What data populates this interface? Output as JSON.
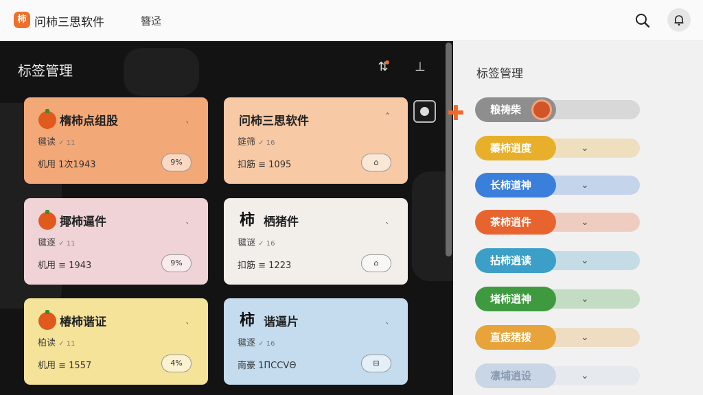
{
  "topbar": {
    "logo_glyph": "柿",
    "app_title": "问柿三思软件",
    "nav_link": "簪迳",
    "icons": [
      "search-icon",
      "bell-icon"
    ]
  },
  "left_panel": {
    "title": "标签管理",
    "header_icons": [
      "sort-icon",
      "upload-icon"
    ],
    "accent": "#ef6a2a",
    "cards": [
      {
        "icon": "tomato",
        "title": "楕柿点组股",
        "sub": "毽读",
        "sub_mark": "✓ 11",
        "stat": "机用 1次1943",
        "pill": "9%",
        "chevron": "ˎ",
        "bg": "#f3a878"
      },
      {
        "icon": "none",
        "title": "问柿三思软件",
        "sub": "筵筛",
        "sub_mark": "✓ 16",
        "stat": "扣筋 ≡ 1095",
        "pill": "⌂",
        "chevron": "ˆ",
        "bg": "#f7c9a4"
      },
      {
        "icon": "tomato",
        "title": "揶柿逼件",
        "sub": "毽逐",
        "sub_mark": "✓ 11",
        "stat": "机用 ≡ 1943",
        "pill": "9%",
        "chevron": "ˎ",
        "bg": "#f0d3d6"
      },
      {
        "icon": "kanji",
        "glyph": "柿",
        "title": "栖猪件",
        "sub": "毽谜",
        "sub_mark": "✓ 16",
        "stat": "扣筋 ≡ 1223",
        "pill": "⌂",
        "chevron": "ˎ",
        "bg": "#f2eeea"
      },
      {
        "icon": "tomato",
        "title": "椿柿谐证",
        "sub": "柏读",
        "sub_mark": "✓ 11",
        "stat": "机用 ≡ 1557",
        "pill": "4%",
        "chevron": "ˎ",
        "bg": "#f5e39a"
      },
      {
        "icon": "kanji",
        "glyph": "柿",
        "title": "谐逼片",
        "sub": "毽逐",
        "sub_mark": "✓ 16",
        "stat": "南豪 1ΠCCVΘ",
        "pill": "⊟",
        "chevron": "ˎ",
        "bg": "#c4dcee"
      }
    ]
  },
  "right_panel": {
    "title": "标签管理",
    "add_icon": "plus-icon",
    "tags": [
      {
        "label": "粮祷柴",
        "color": "#8e8e8e",
        "has_chevron": false
      },
      {
        "label": "蓁柿逍度",
        "color": "#e8b02a",
        "has_chevron": true
      },
      {
        "label": "长柿道神",
        "color": "#3a7fdc",
        "has_chevron": true
      },
      {
        "label": "茶柿逍件",
        "color": "#e8642e",
        "has_chevron": true
      },
      {
        "label": "拈柿逍读",
        "color": "#3b9fc8",
        "has_chevron": true
      },
      {
        "label": "堵柿逍神",
        "color": "#3f9a3f",
        "has_chevron": true
      },
      {
        "label": "直痣猪拨",
        "color": "#e8a43a",
        "has_chevron": true
      },
      {
        "label": "凛埔逍设",
        "color": "#c9d6e6",
        "has_chevron": true
      }
    ]
  }
}
